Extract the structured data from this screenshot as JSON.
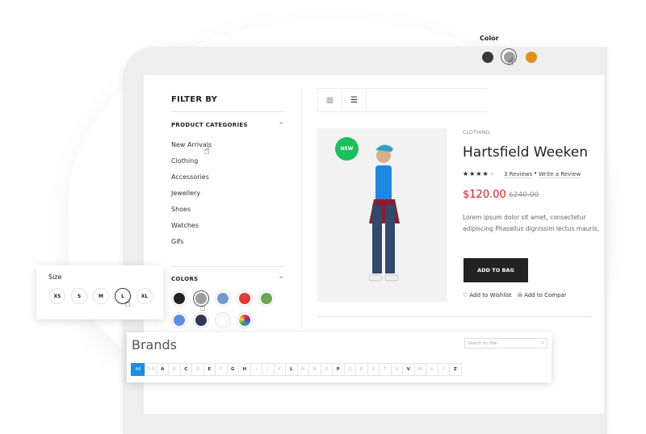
{
  "color_picker": {
    "label": "Color",
    "swatches": [
      "#3a3a3a",
      "#9e9e9e",
      "#e0901a"
    ],
    "selected": 1
  },
  "filter": {
    "title": "FILTER BY",
    "categories_title": "PRODUCT CATEGORIES",
    "collapse": "–",
    "categories": [
      "New Arrivals",
      "Clothing",
      "Accessories",
      "Jewellery",
      "Shoes",
      "Watches",
      "Gifs"
    ],
    "colors_title": "COLORS",
    "colors": [
      "#222222",
      "#9e9e9e",
      "#6f9bc8",
      "#e53935",
      "#6aa84f",
      "#5b8fe0",
      "#2e3a55",
      "#ffffff",
      "conic"
    ],
    "selected_color": 1
  },
  "size": {
    "label": "Size",
    "options": [
      "XS",
      "S",
      "M",
      "L",
      "XL"
    ],
    "selected": 3
  },
  "product": {
    "badge": "NEW",
    "category": "CLOTHING",
    "title": "Hartsfield Weekend",
    "rating": 4,
    "max_rating": 5,
    "reviews": "3 Reviews",
    "write_review": "Write a Review",
    "price": "$120.00",
    "old_price": "$240.00",
    "description": "Lorem ipsum dolor sit amet, consectetur adipiscing Phasellus dignissim lectus mauris, quis acumin",
    "add_to_bag": "ADD TO BAG",
    "wishlist": "Add to Wishlist",
    "compare": "Add to Compare",
    "accent": "#e8141c",
    "badge_color": "#1bbf5c"
  },
  "brands": {
    "title": "Brands",
    "search_placeholder": "Search by title",
    "letters": [
      "All",
      "0-9",
      "A",
      "B",
      "C",
      "D",
      "E",
      "F",
      "G",
      "H",
      "I",
      "J",
      "K",
      "L",
      "M",
      "N",
      "O",
      "P",
      "Q",
      "R",
      "S",
      "T",
      "U",
      "V",
      "W",
      "X",
      "Y",
      "Z"
    ],
    "active_letters": [
      "A",
      "C",
      "E",
      "G",
      "H",
      "L",
      "P",
      "V",
      "Z"
    ]
  }
}
